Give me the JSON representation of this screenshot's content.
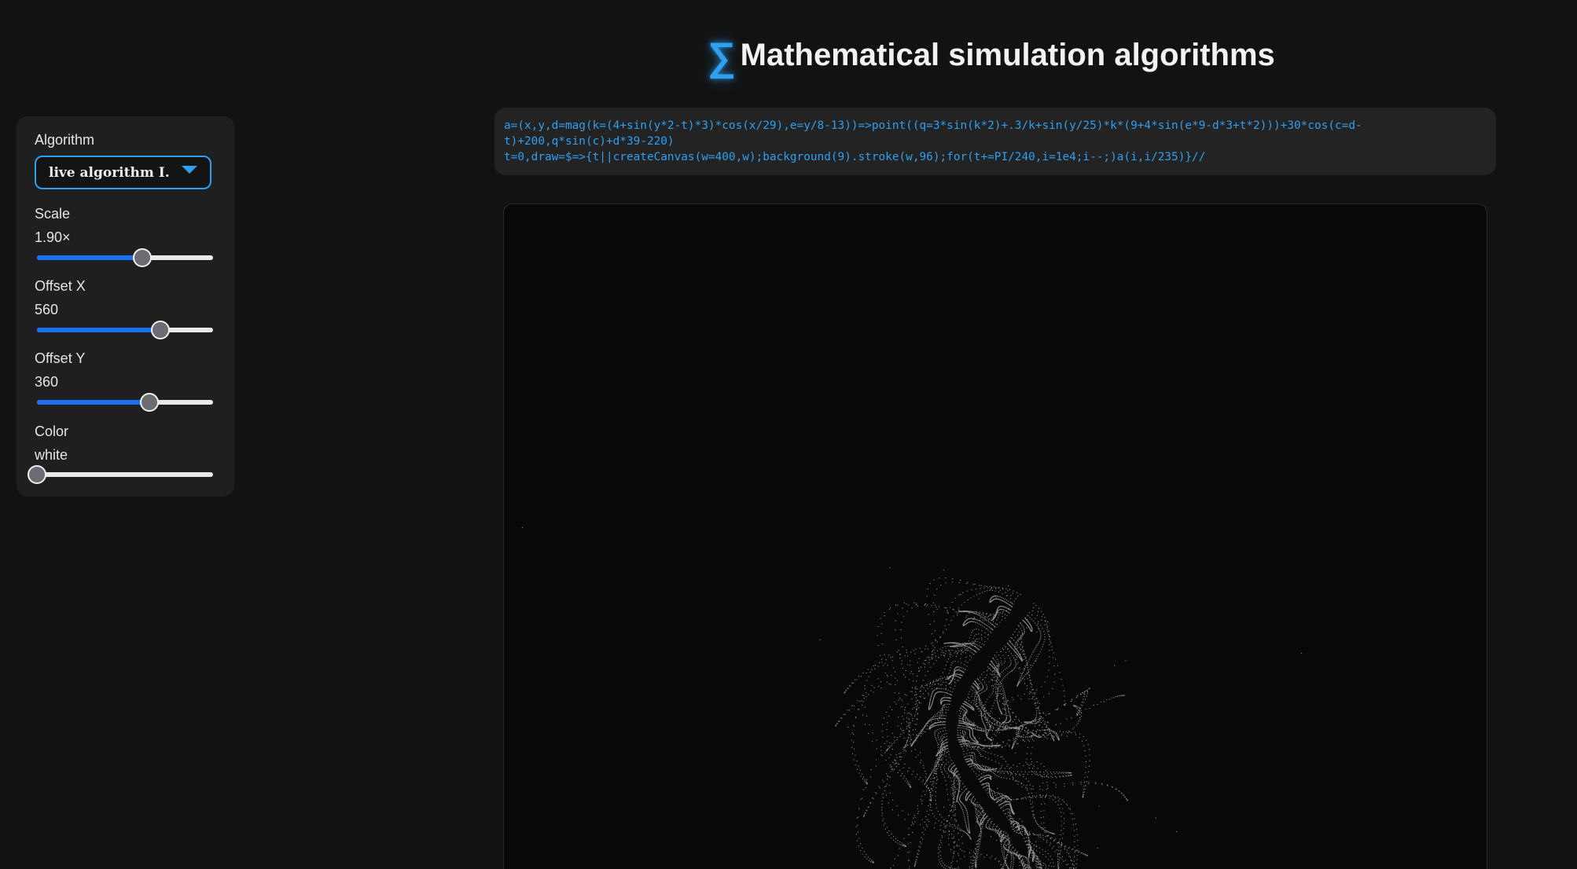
{
  "header": {
    "title_icon": "∑",
    "title": "Mathematical simulation algorithms"
  },
  "controls": {
    "algorithm": {
      "label": "Algorithm",
      "selected": "live algorithm I."
    },
    "scale": {
      "label": "Scale",
      "value": "1.90×",
      "fraction": 0.6
    },
    "offset_x": {
      "label": "Offset X",
      "value": "560",
      "fraction": 0.7
    },
    "offset_y": {
      "label": "Offset Y",
      "value": "360",
      "fraction": 0.64
    },
    "color": {
      "label": "Color",
      "value": "white",
      "fraction": 0.0
    }
  },
  "code": {
    "line1": "a=(x,y,d=mag(k=(4+sin(y*2-t)*3)*cos(x/29),e=y/8-13))=>point((q=3*sin(k*2)+.3/k+sin(y/25)*k*(9+4*sin(e*9-d*3+t*2)))+30*cos(c=d-",
    "line2": "t)+200,q*sin(c)+d*39-220)",
    "line3": "t=0,draw=$=>{t||createCanvas(w=400,w);background(9).stroke(w,96);for(t+=PI/240,i=1e4;i--;)a(i,i/235)}//"
  },
  "colors": {
    "accent": "#2f9ff0",
    "slider_fill": "#1a6ef0",
    "background": "#121212",
    "panel": "#1f1f1f",
    "canvas": "#080808"
  }
}
